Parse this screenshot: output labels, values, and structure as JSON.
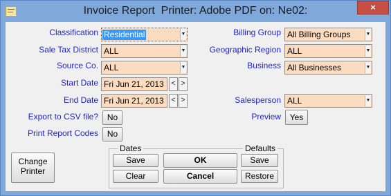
{
  "window": {
    "title": "Invoice Report  Printer: Adobe PDF on: Ne02:",
    "close_glyph": "×"
  },
  "fields": {
    "classification_label": "Classification",
    "classification_value": "Residential",
    "sale_tax_label": "Sale Tax District",
    "sale_tax_value": "ALL",
    "source_label": "Source Co.",
    "source_value": "ALL",
    "start_date_label": "Start Date",
    "start_date_value": "Fri Jun 21, 2013",
    "end_date_label": "End Date",
    "end_date_value": "Fri Jun 21, 2013",
    "export_label": "Export to CSV file?",
    "export_value": "No",
    "print_codes_label": "Print Report Codes",
    "print_codes_value": "No",
    "billing_group_label": "Billing Group",
    "billing_group_value": "All Billing Groups",
    "geo_region_label": "Geographic Region",
    "geo_region_value": "ALL",
    "business_label": "Business",
    "business_value": "All Businesses",
    "salesperson_label": "Salesperson",
    "salesperson_value": "ALL",
    "preview_label": "Preview",
    "preview_value": "Yes"
  },
  "buttons": {
    "change_printer": "Change\nPrinter",
    "dates_legend": "Dates",
    "defaults_legend": "Defaults",
    "dates_save": "Save",
    "dates_clear": "Clear",
    "ok": "OK",
    "cancel": "Cancel",
    "defaults_save": "Save",
    "restore": "Restore"
  },
  "spinners": {
    "prev": "<",
    "next": ">"
  }
}
